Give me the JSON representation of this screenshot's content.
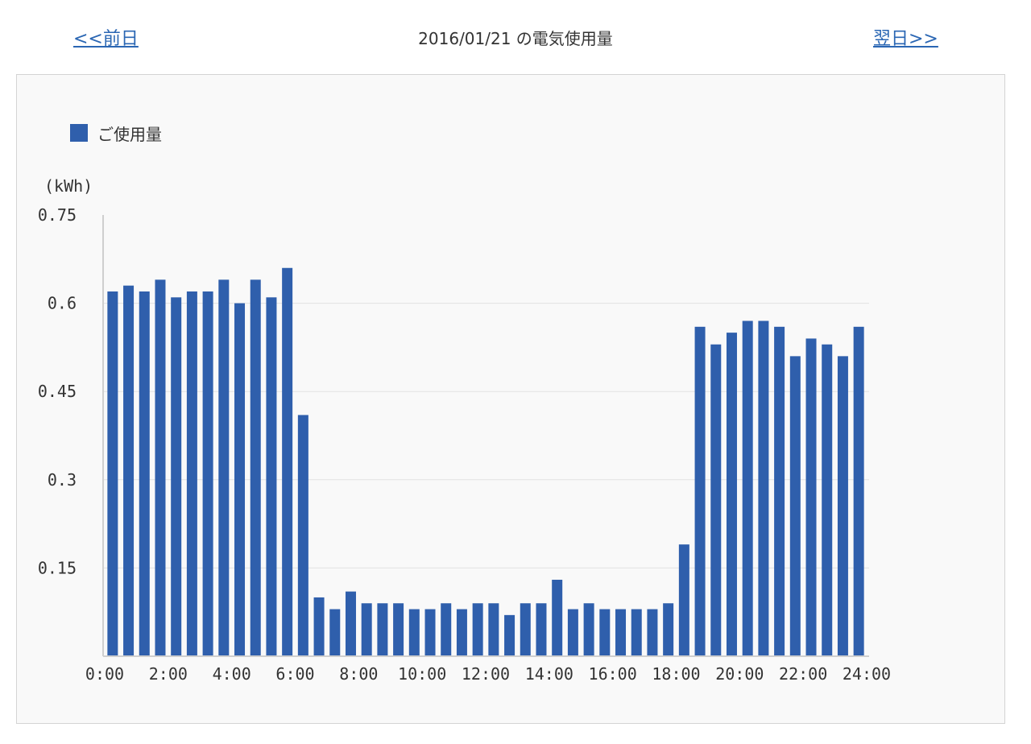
{
  "nav": {
    "prev_label": "<<前日",
    "next_label": "翌日>>"
  },
  "page": {
    "title": "2016/01/21 の電気使用量"
  },
  "colors": {
    "bar": "#2f5fac",
    "grid": "#e2e2e2",
    "axis": "#cfcfcf",
    "link": "#2a66b3"
  },
  "chart_data": {
    "type": "bar",
    "unit_label": "(kWh)",
    "legend_position": "top-left",
    "grid": true,
    "ylim": [
      0,
      0.75
    ],
    "y_ticks": [
      "0.75",
      "0.6",
      "0.45",
      "0.3",
      "0.15"
    ],
    "y_tick_values": [
      0.75,
      0.6,
      0.45,
      0.3,
      0.15
    ],
    "xlim": [
      0,
      24
    ],
    "x_ticks": [
      "0:00",
      "2:00",
      "4:00",
      "6:00",
      "8:00",
      "10:00",
      "12:00",
      "14:00",
      "16:00",
      "18:00",
      "20:00",
      "22:00",
      "24:00"
    ],
    "x_tick_values": [
      0,
      2,
      4,
      6,
      8,
      10,
      12,
      14,
      16,
      18,
      20,
      22,
      24
    ],
    "series": [
      {
        "name": "ご使用量",
        "x": [
          0,
          0.5,
          1,
          1.5,
          2,
          2.5,
          3,
          3.5,
          4,
          4.5,
          5,
          5.5,
          6,
          6.5,
          7,
          7.5,
          8,
          8.5,
          9,
          9.5,
          10,
          10.5,
          11,
          11.5,
          12,
          12.5,
          13,
          13.5,
          14,
          14.5,
          15,
          15.5,
          16,
          16.5,
          17,
          17.5,
          18,
          18.5,
          19,
          19.5,
          20,
          20.5,
          21,
          21.5,
          22,
          22.5,
          23,
          23.5
        ],
        "values": [
          0.62,
          0.63,
          0.62,
          0.64,
          0.61,
          0.62,
          0.62,
          0.64,
          0.6,
          0.64,
          0.61,
          0.66,
          0.41,
          0.1,
          0.08,
          0.11,
          0.09,
          0.09,
          0.09,
          0.08,
          0.08,
          0.09,
          0.08,
          0.09,
          0.09,
          0.07,
          0.09,
          0.09,
          0.13,
          0.08,
          0.09,
          0.08,
          0.08,
          0.08,
          0.08,
          0.09,
          0.19,
          0.56,
          0.53,
          0.55,
          0.57,
          0.57,
          0.56,
          0.51,
          0.54,
          0.53,
          0.51,
          0.56
        ]
      }
    ]
  }
}
